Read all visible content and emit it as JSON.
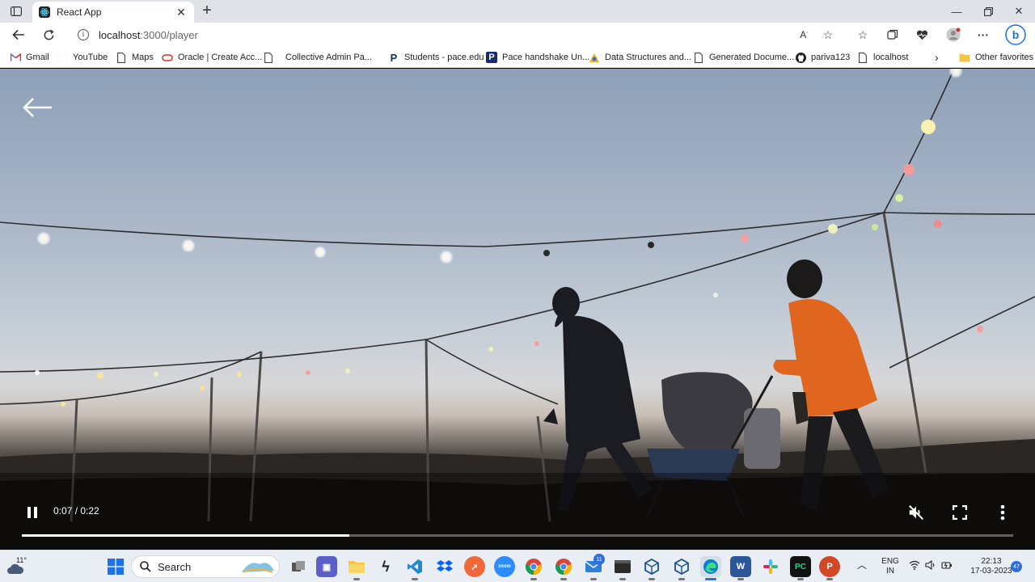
{
  "browser": {
    "tab_title": "React App",
    "url_host": "localhost",
    "url_rest": ":3000/player",
    "bookmarks": [
      {
        "label": "Gmail",
        "icon": "gmail-icon"
      },
      {
        "label": "YouTube",
        "icon": "youtube-icon"
      },
      {
        "label": "Maps",
        "icon": "page-icon"
      },
      {
        "label": "Oracle | Create Acc...",
        "icon": "oracle-icon"
      },
      {
        "label": "Collective Admin Pa...",
        "icon": "page-icon"
      },
      {
        "label": "Students - pace.edu",
        "icon": "pace-icon"
      },
      {
        "label": "Pace handshake Un...",
        "icon": "pace-icon"
      },
      {
        "label": "Data Structures and...",
        "icon": "ds-icon"
      },
      {
        "label": "Generated Docume...",
        "icon": "page-icon"
      },
      {
        "label": "pariva123",
        "icon": "github-icon"
      },
      {
        "label": "localhost",
        "icon": "page-icon"
      }
    ],
    "other_favorites": "Other favorites"
  },
  "player": {
    "current_time": "0:07",
    "duration": "0:22",
    "time_display": "0:07 / 0:22",
    "progress_fraction": 0.33,
    "state": "playing",
    "muted": true
  },
  "taskbar": {
    "weather_temp": "11°",
    "search_label": "Search",
    "lang_line1": "ENG",
    "lang_line2": "IN",
    "clock_time": "22:13",
    "clock_date": "17-03-2023",
    "mail_badge": "11",
    "notification_badge": "47"
  }
}
